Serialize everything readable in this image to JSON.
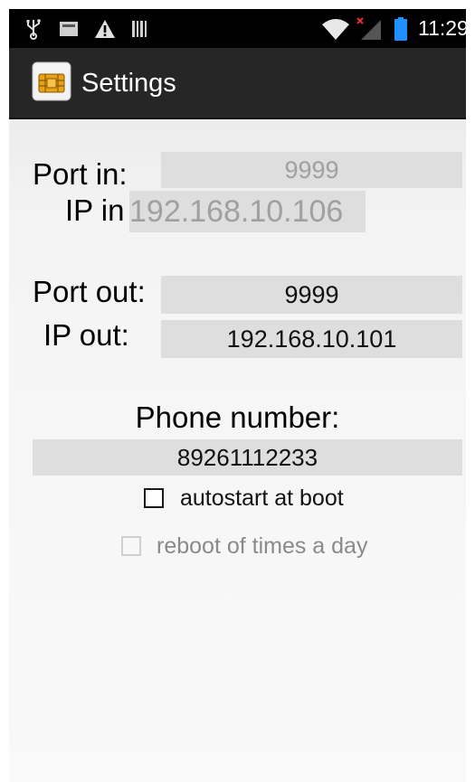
{
  "status_bar": {
    "time": "11:29",
    "icons": [
      "usb-icon",
      "sdcard-icon",
      "warning-icon",
      "barcode-icon",
      "wifi-icon",
      "signal-icon",
      "battery-icon"
    ]
  },
  "action_bar": {
    "title": "Settings",
    "app_icon": "sim-card-icon"
  },
  "form": {
    "port_in": {
      "label": "Port in:",
      "value": "9999"
    },
    "ip_in": {
      "label": "IP in",
      "value": "192.168.10.106"
    },
    "port_out": {
      "label": "Port out:",
      "value": "9999"
    },
    "ip_out": {
      "label": "IP out:",
      "value": "192.168.10.101"
    },
    "phone": {
      "label": "Phone number:",
      "value": "89261112233"
    },
    "autostart": {
      "label": "autostart at boot",
      "checked": false
    },
    "reboot": {
      "label": "reboot of times a day",
      "checked": false,
      "enabled": false
    }
  },
  "colors": {
    "status_bar": "#000000",
    "action_bar": "#262626",
    "field_bg": "#dedede",
    "battery": "#1e90ff"
  }
}
